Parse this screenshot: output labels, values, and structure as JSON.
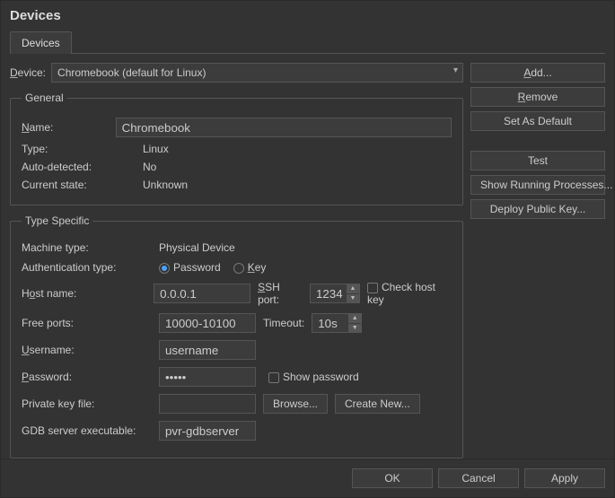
{
  "dialog": {
    "title": "Devices",
    "tabs": [
      {
        "label": "Devices"
      }
    ]
  },
  "device_row": {
    "label": "Device:",
    "selected": "Chromebook (default for Linux)"
  },
  "general": {
    "legend": "General",
    "name_label": "Name:",
    "name_value": "Chromebook",
    "type_label": "Type:",
    "type_value": "Linux",
    "auto_label": "Auto-detected:",
    "auto_value": "No",
    "state_label": "Current state:",
    "state_value": "Unknown"
  },
  "typespec": {
    "legend": "Type Specific",
    "machine_label": "Machine type:",
    "machine_value": "Physical Device",
    "auth_label": "Authentication type:",
    "auth_pass": "Password",
    "auth_key": "Key",
    "host_label": "Host name:",
    "host_value": "0.0.0.1",
    "ssh_label": "SSH port:",
    "ssh_value": "1234",
    "checkhost_label": "Check host key",
    "free_label": "Free ports:",
    "free_value": "10000-10100",
    "timeout_label": "Timeout:",
    "timeout_value": "10s",
    "user_label": "Username:",
    "user_value": "username",
    "pass_label": "Password:",
    "pass_value": "•••••",
    "showpass_label": "Show password",
    "pkf_label": "Private key file:",
    "pkf_value": "",
    "browse": "Browse...",
    "createnew": "Create New...",
    "gdb_label": "GDB server executable:",
    "gdb_value": "pvr-gdbserver"
  },
  "side": {
    "add": "Add...",
    "remove": "Remove",
    "default": "Set As Default",
    "test": "Test",
    "procs": "Show Running Processes...",
    "deploy": "Deploy Public Key..."
  },
  "footer": {
    "ok": "OK",
    "cancel": "Cancel",
    "apply": "Apply"
  }
}
